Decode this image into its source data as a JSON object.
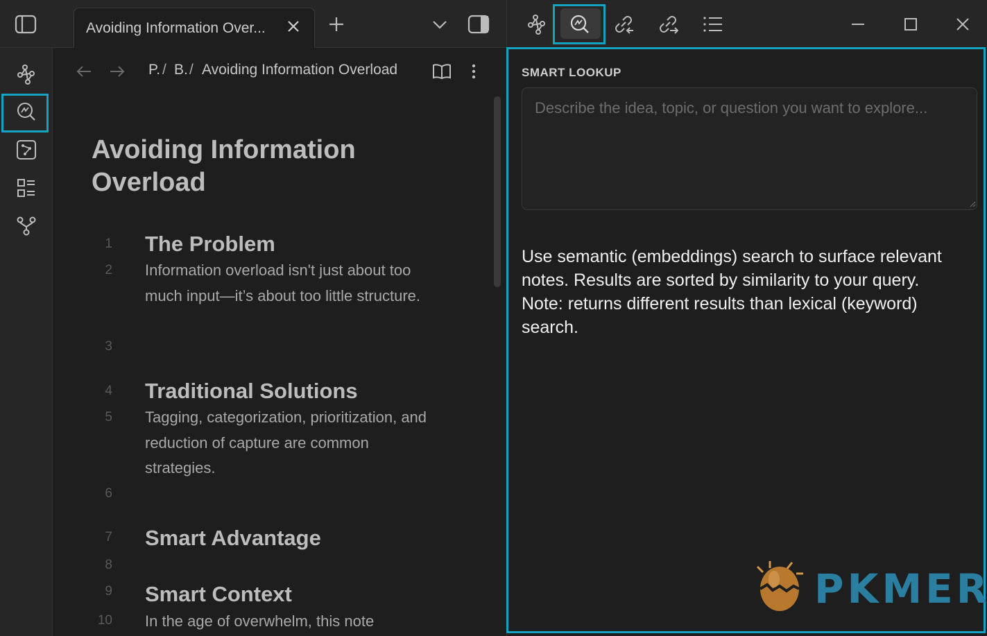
{
  "tab": {
    "title": "Avoiding Information Over..."
  },
  "breadcrumb": {
    "p1": "P.",
    "sep1": "/",
    "p2": "B.",
    "sep2": "/",
    "current": "Avoiding Information Overload"
  },
  "document": {
    "title": "Avoiding Information Overload",
    "line_numbers": [
      "1",
      "2",
      "3",
      "4",
      "5",
      "6",
      "7",
      "8",
      "9",
      "10"
    ],
    "sections": [
      {
        "heading": "The Problem",
        "body": "Information overload isn't just about too much input—it’s about too little structure."
      },
      {
        "heading": "Traditional Solutions",
        "body": "Tagging, categorization, prioritization, and reduction of capture are common strategies."
      },
      {
        "heading": "Smart Advantage",
        "body": ""
      },
      {
        "heading": "Smart Context",
        "body": "In the age of overwhelm, this note"
      }
    ]
  },
  "smart_lookup": {
    "label": "SMART LOOKUP",
    "placeholder": "Describe the idea, topic, or question you want to explore...",
    "description": "Use semantic (embeddings) search to surface relevant notes. Results are sorted by similarity to your query. Note: returns different results than lexical (keyword) search."
  },
  "watermark": {
    "text": "PKMER"
  },
  "colors": {
    "highlight": "#13a2c4",
    "background": "#1e1e1e",
    "panel": "#262626"
  },
  "icons": [
    "sidebar-toggle-icon",
    "close-icon",
    "plus-icon",
    "chevron-down-icon",
    "right-sidebar-icon",
    "connections-icon",
    "smart-lookup-icon",
    "backlinks-icon",
    "outgoing-links-icon",
    "outline-icon",
    "minimize-icon",
    "maximize-icon",
    "window-close-icon",
    "back-arrow-icon",
    "forward-arrow-icon",
    "reading-view-icon",
    "more-options-icon",
    "graph-icon",
    "canvas-icon",
    "bases-icon",
    "branch-icon"
  ]
}
